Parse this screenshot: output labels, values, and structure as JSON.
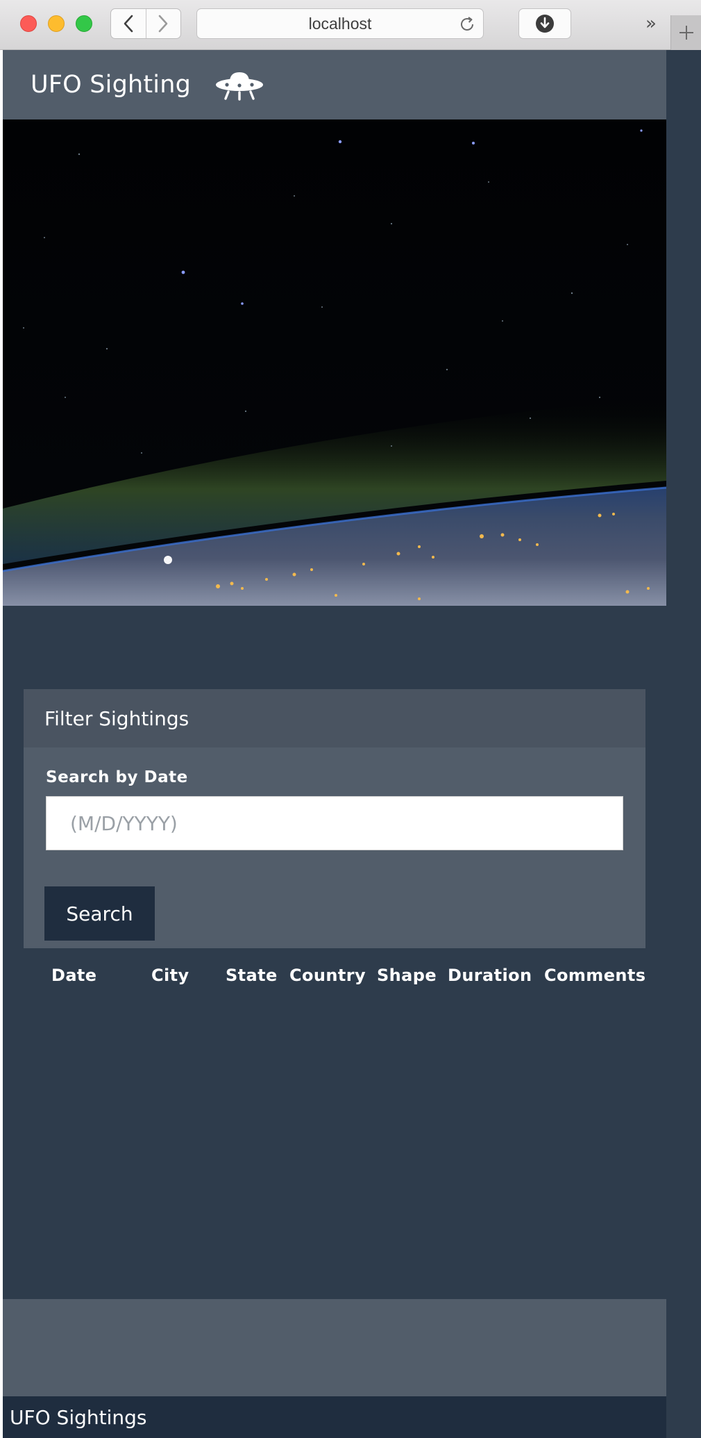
{
  "browser": {
    "address": "localhost",
    "controls": {
      "close": "close-window",
      "minimize": "minimize-window",
      "zoom": "zoom-window"
    },
    "overflow_label": "»"
  },
  "navbar": {
    "brand": "UFO Sighting",
    "icon": "ufo-icon"
  },
  "hero": {
    "image": "earth-from-orbit-night"
  },
  "filter": {
    "heading": "Filter Sightings",
    "date_label": "Search by Date",
    "date_placeholder": "(M/D/YYYY)",
    "date_value": "",
    "search_label": "Search"
  },
  "table": {
    "columns": [
      "Date",
      "City",
      "State",
      "Country",
      "Shape",
      "Duration",
      "Comments"
    ],
    "rows": []
  },
  "footer": {
    "text": "UFO Sightings"
  },
  "colors": {
    "page_bg": "#2e3c4c",
    "panel_bg": "#525d6a",
    "panel_heading_bg": "#4a5461",
    "button_bg": "#1f2d3f",
    "footer_bg": "#1f2d3f"
  }
}
